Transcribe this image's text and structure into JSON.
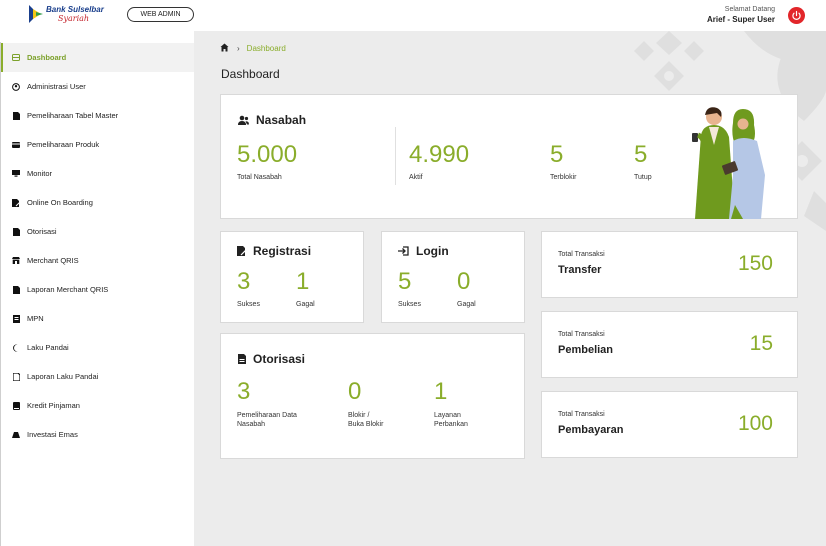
{
  "header": {
    "logo_line1": "Bank Sulselbar",
    "logo_line2": "Syariah",
    "web_admin_label": "WEB ADMIN",
    "greeting": "Selamat Datang",
    "user": "Arief - Super User"
  },
  "sidebar": {
    "items": [
      {
        "label": "Dashboard",
        "icon": "dashboard-icon"
      },
      {
        "label": "Administrasi User",
        "icon": "user-circle-icon"
      },
      {
        "label": "Pemeliharaan Tabel Master",
        "icon": "document-icon"
      },
      {
        "label": "Pemeliharaan Produk",
        "icon": "card-icon"
      },
      {
        "label": "Monitor",
        "icon": "monitor-icon"
      },
      {
        "label": "Online On Boarding",
        "icon": "edit-document-icon"
      },
      {
        "label": "Otorisasi",
        "icon": "document-icon"
      },
      {
        "label": "Merchant QRIS",
        "icon": "store-icon"
      },
      {
        "label": "Laporan Merchant QRIS",
        "icon": "document-icon"
      },
      {
        "label": "MPN",
        "icon": "document-icon"
      },
      {
        "label": "Laku Pandai",
        "icon": "crescent-icon"
      },
      {
        "label": "Laporan Laku Pandai",
        "icon": "document-icon"
      },
      {
        "label": "Kredit Pinjaman",
        "icon": "book-icon"
      },
      {
        "label": "Investasi Emas",
        "icon": "gold-icon"
      }
    ]
  },
  "breadcrumb": {
    "current": "Dashboard"
  },
  "page_title": "Dashboard",
  "nasabah": {
    "title": "Nasabah",
    "total_value": "5.000",
    "total_label": "Total Nasabah",
    "aktif_value": "4.990",
    "aktif_label": "Aktif",
    "terblokir_value": "5",
    "terblokir_label": "Terblokir",
    "tutup_value": "5",
    "tutup_label": "Tutup"
  },
  "registrasi": {
    "title": "Registrasi",
    "sukses_value": "3",
    "sukses_label": "Sukses",
    "gagal_value": "1",
    "gagal_label": "Gagal"
  },
  "login": {
    "title": "Login",
    "sukses_value": "5",
    "sukses_label": "Sukses",
    "gagal_value": "0",
    "gagal_label": "Gagal"
  },
  "otorisasi": {
    "title": "Otorisasi",
    "items": [
      {
        "value": "3",
        "label1": "Pemeliharaan Data",
        "label2": "Nasabah"
      },
      {
        "value": "0",
        "label1": "Blokir /",
        "label2": "Buka Blokir"
      },
      {
        "value": "1",
        "label1": "Layanan",
        "label2": "Perbankan"
      }
    ]
  },
  "transaksi": [
    {
      "small": "Total Transaksi",
      "name": "Transfer",
      "value": "150"
    },
    {
      "small": "Total Transaksi",
      "name": "Pembelian",
      "value": "15"
    },
    {
      "small": "Total Transaksi",
      "name": "Pembayaran",
      "value": "100"
    }
  ],
  "colors": {
    "accent": "#8aad2b",
    "power": "#e2262a",
    "brand_blue": "#1a3f8c"
  }
}
